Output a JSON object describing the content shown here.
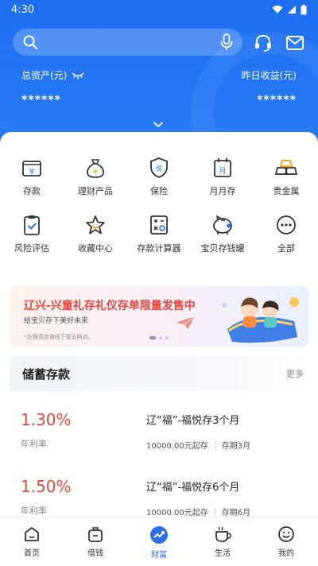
{
  "status_bar": {
    "time": "4:30"
  },
  "header": {
    "total_assets_label": "总资产(元)",
    "total_assets_value": "******",
    "yesterday_income_label": "昨日收益(元)",
    "yesterday_income_value": "******"
  },
  "colors": {
    "brand_blue": "#2b7cf6",
    "rate_red": "#e8453c",
    "active_tab": "#2b6fe8"
  },
  "quick_menu": [
    {
      "label": "存款",
      "icon": "deposit-icon"
    },
    {
      "label": "理财产品",
      "icon": "money-bag-icon"
    },
    {
      "label": "保险",
      "icon": "insurance-shield-icon"
    },
    {
      "label": "月月存",
      "icon": "calendar-icon"
    },
    {
      "label": "贵金属",
      "icon": "gold-bars-icon"
    },
    {
      "label": "风险评估",
      "icon": "clipboard-check-icon"
    },
    {
      "label": "收藏中心",
      "icon": "star-icon"
    },
    {
      "label": "存款计算器",
      "icon": "calculator-icon"
    },
    {
      "label": "宝贝存钱罐",
      "icon": "piggy-bank-icon"
    },
    {
      "label": "全部",
      "icon": "more-icon"
    }
  ],
  "banner": {
    "title": "辽兴-兴童礼存礼仪存单限量发售中",
    "subtitle": "给宝贝存下美好未来",
    "note": "*办理请咨询线下营业网点。"
  },
  "savings": {
    "title": "储蓄存款",
    "more": "更多",
    "products": [
      {
        "rate": "1.30%",
        "rate_label": "年利率",
        "name": "辽“福”-福悦存3个月",
        "min": "10000.00元起存",
        "term": "存期3月"
      },
      {
        "rate": "1.50%",
        "rate_label": "年利率",
        "name": "辽“福”-福悦存6个月",
        "min": "10000.00元起存",
        "term": "存期6月"
      }
    ]
  },
  "tabs": [
    {
      "label": "首页",
      "icon": "home-icon"
    },
    {
      "label": "借钱",
      "icon": "wallet-icon"
    },
    {
      "label": "财富",
      "icon": "wealth-icon",
      "active": true
    },
    {
      "label": "生活",
      "icon": "coffee-icon"
    },
    {
      "label": "我的",
      "icon": "profile-icon"
    }
  ]
}
